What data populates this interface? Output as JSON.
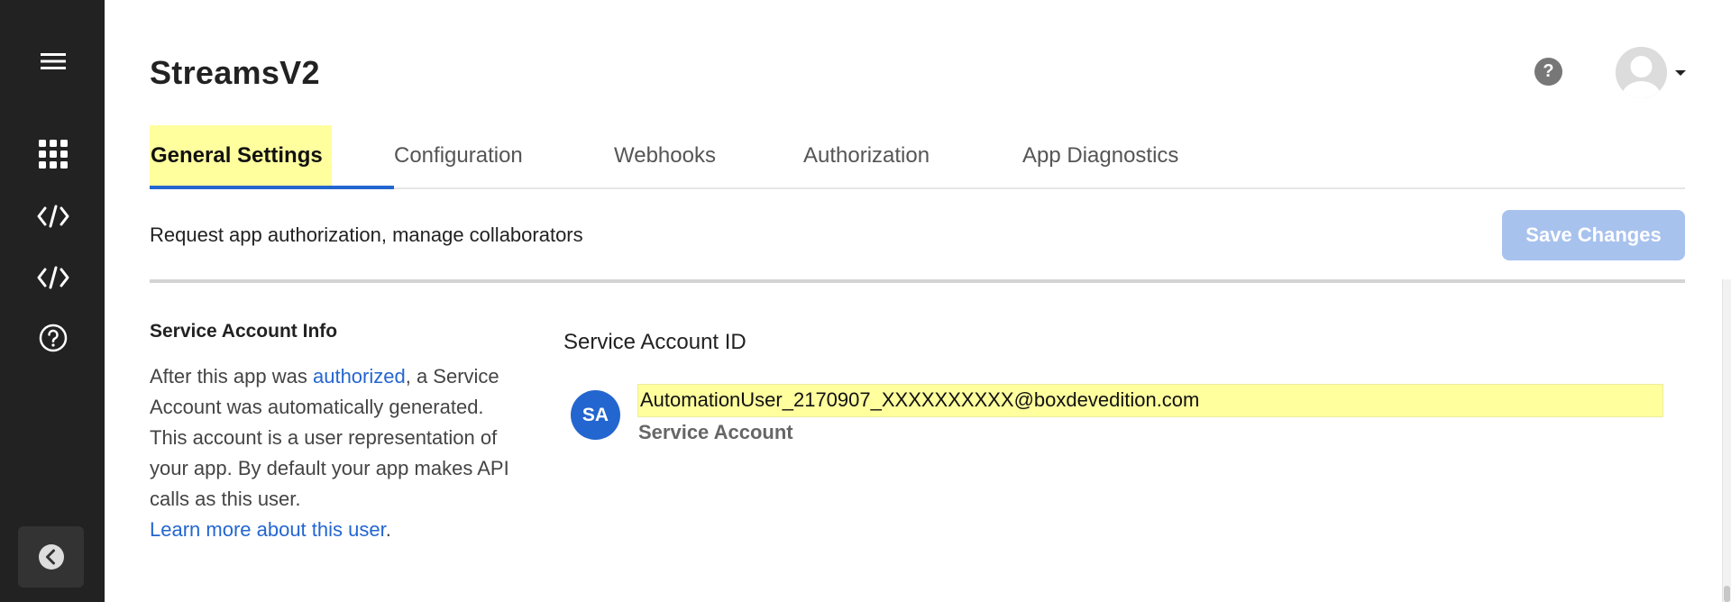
{
  "header": {
    "title": "StreamsV2",
    "help_symbol": "?"
  },
  "sidebar": {
    "items": [
      {
        "icon": "hamburger-menu-icon"
      },
      {
        "icon": "grid-apps-icon"
      },
      {
        "icon": "code-icon"
      },
      {
        "icon": "code-icon"
      },
      {
        "icon": "help-circle-icon"
      }
    ],
    "collapse_icon": "chevron-left-icon"
  },
  "tabs": [
    {
      "label": "General Settings",
      "active": true
    },
    {
      "label": "Configuration",
      "active": false
    },
    {
      "label": "Webhooks",
      "active": false
    },
    {
      "label": "Authorization",
      "active": false
    },
    {
      "label": "App Diagnostics",
      "active": false
    }
  ],
  "subheader": {
    "description": "Request app authorization, manage collaborators",
    "save_label": "Save Changes"
  },
  "service_account_info": {
    "title": "Service Account Info",
    "desc_before": "After this app was ",
    "desc_link": "authorized",
    "desc_after": ", a Service Account was automatically generated. This account is a user representation of your app. By default your app makes API calls as this user.",
    "learn_more": "Learn more about this user",
    "learn_more_suffix": "."
  },
  "service_account": {
    "label": "Service Account ID",
    "initials": "SA",
    "email": "AutomationUser_2170907_XXXXXXXXXX@boxdevedition.com",
    "type": "Service Account"
  },
  "colors": {
    "sidebar_bg": "#222222",
    "accent_blue": "#2466cf",
    "highlight_yellow": "#ffff9e",
    "save_button_disabled": "#a8c2ee"
  }
}
